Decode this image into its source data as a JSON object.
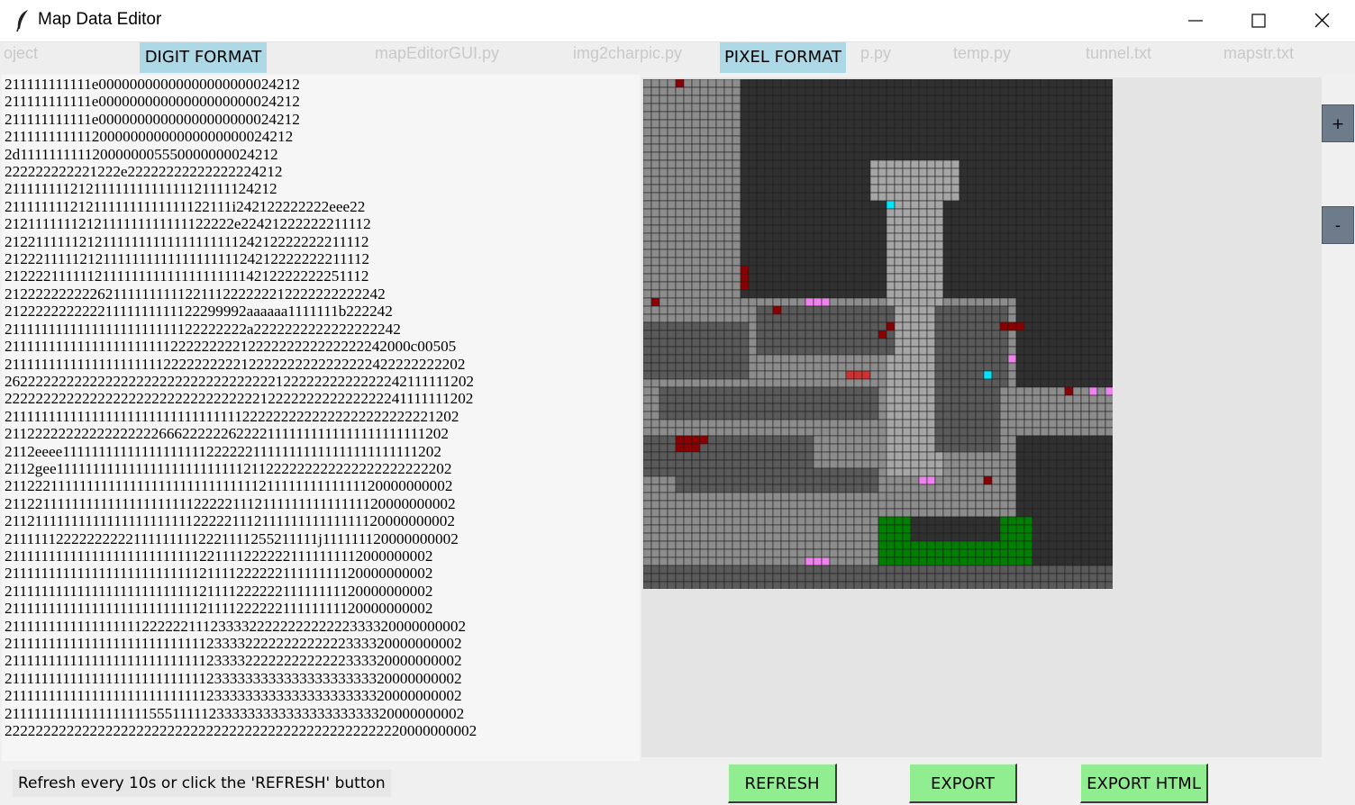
{
  "window": {
    "title": "Map Data Editor",
    "controls": {
      "minimize": "minimize-icon",
      "maximize": "maximize-icon",
      "close": "close-icon"
    }
  },
  "background_ghost": [
    "oject",
    "mapEditorGUI.py",
    "img2charpic.py",
    "p.py",
    "temp.py",
    "tunnel.txt",
    "mapstr.txt"
  ],
  "labels": {
    "digit_format": "DIGIT FORMAT",
    "pixel_format": "PIXEL FORMAT"
  },
  "digit_lines": [
    "211111111111e00000000000000000000024212",
    "211111111111e00000000000000000000024212",
    "211111111111e00000000000000000000024212",
    "21111111111120000000000000000000024212",
    "2d1111111111200000005550000000024212",
    "222222222221222e22222222222222224212",
    "2111111112121111111111111121111124212",
    "2111111112121111111111111122111i242122222222eee22",
    "2121111111212111111111111122222e22421222222211112",
    "2122111111212111111111111111111124212222222211112",
    "2122211111212111111111111111111124212222222211112",
    "2122221111112111111111111111111114212222222251112",
    "21222222222262111111111122111222222212222222222242",
    "21222222222221111111111122299992aaaaaa1111111b222242",
    "211111111111111111111111122222222a2222222222222222242",
    "211111111111111111111112222222221222222222222222242000c00505",
    "2111111111111111111111222222222212222222222222222422222222202",
    "2622222222222222222222222222222222212222222222222242111111202",
    "2222222222222222222222222222222221222222222222222241111111202",
    "2111111111111111111111111111111112222222222222222222222221202",
    "21122222222222222222666222222622221111111111111111111111202",
    "2112eeee1111111111111111111122222211111111111111111111111202",
    "2112gee11111111111111111111111111211222222222222222222222202",
    "2112221111111111111111111111111111121111111111111120000000002",
    "2112211111111111111111111122222111211111111111111120000000002",
    "2112111111111111111111111122222111211111111111111120000000002",
    "211111122222222221111111112221111255211111j111111120000000002",
    "2111111111111111111111111112211112222221111111112000000002",
    "2111111111111111111111111112111122222211111111120000000002",
    "2111111111111111111111111112111122222211111111120000000002",
    "2111111111111111111111111112111122222211111111120000000002",
    "2111111111111111111222222111233332222222222222333320000000002",
    "2111111111111111111111111111233332222222222222333320000000002",
    "2111111111111111111111111111233332222222222222333320000000002",
    "2111111111111111111111111111233333333333333333333320000000002",
    "2111111111111111111111111111233333333333333333333320000000002",
    "2111111111111111111155511111233333333333333333333320000000002",
    "2222222222222222222222222222222222222222222222222220000000002"
  ],
  "zoom": {
    "in": "+",
    "out": "-"
  },
  "status": "Refresh every 10s or click the 'REFRESH' button",
  "buttons": {
    "refresh": "REFRESH",
    "export": "EXPORT",
    "export_html": "EXPORT HTML"
  },
  "pixel_map": {
    "cols": 58,
    "rows": 63,
    "palette": {
      "dark": "#303030",
      "mid": "#5a5a5a",
      "light": "#8c8c8c",
      "pale": "#a6a6a6",
      "darkred": "#8b0000",
      "red": "#d03030",
      "violet": "#ee82ee",
      "cyan": "#00e5ff",
      "green": "#008000",
      "grid": "#1e1e1e"
    }
  }
}
